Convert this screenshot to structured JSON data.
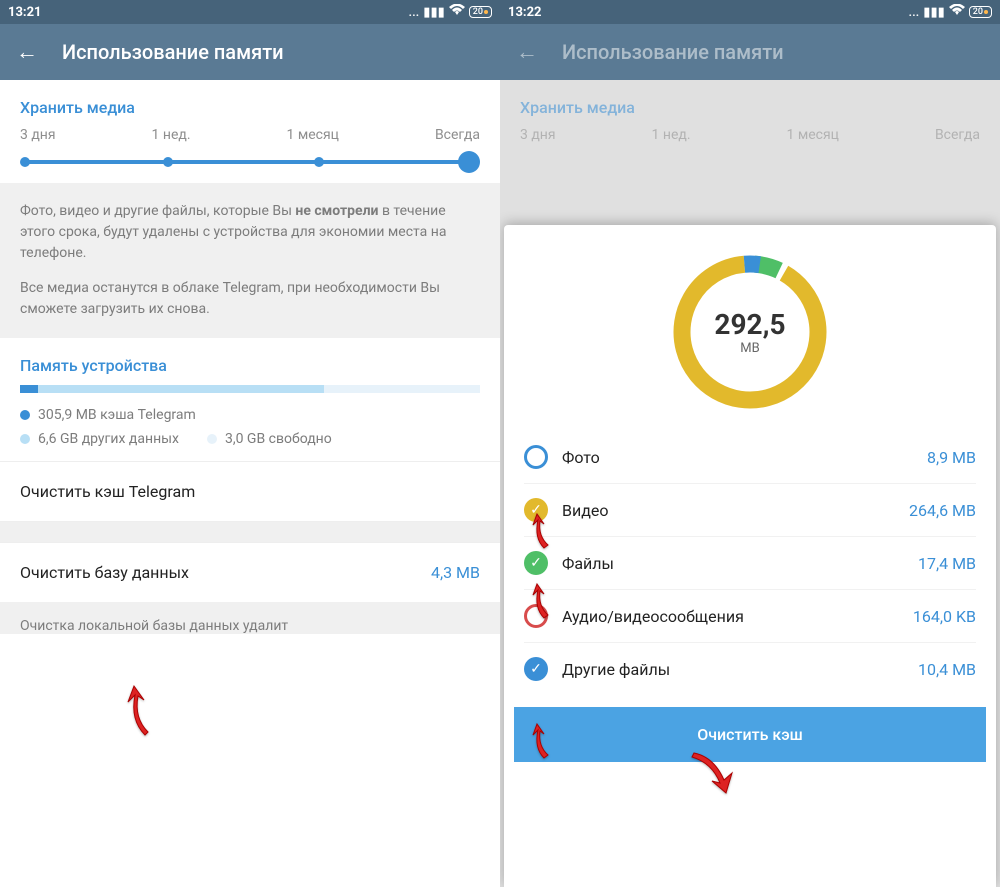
{
  "left": {
    "status": {
      "time": "13:21",
      "battery": "20"
    },
    "appbar": {
      "title": "Использование памяти"
    },
    "keep_media": {
      "title": "Хранить медиа",
      "ticks": [
        "3 дня",
        "1 нед.",
        "1 месяц",
        "Всегда"
      ]
    },
    "info": {
      "p1a": "Фото, видео и другие файлы, которые Вы ",
      "p1b": "не смотрели",
      "p1c": " в течение этого срока, будут удалены с устройства для экономии места на телефоне.",
      "p2": "Все медиа останутся в облаке Telegram, при необходимости Вы сможете загрузить их снова."
    },
    "device_memory": {
      "title": "Память устройства",
      "legend1": "305,9 MB кэша Telegram",
      "legend2": "6,6 GB других данных",
      "legend3": "3,0 GB свободно"
    },
    "clear_cache": {
      "label": "Очистить кэш Telegram"
    },
    "clear_db": {
      "label": "Очистить базу данных",
      "value": "4,3 MB"
    },
    "note": "Очистка локальной базы данных удалит"
  },
  "right": {
    "status": {
      "time": "13:22",
      "battery": "20"
    },
    "appbar": {
      "title": "Использование памяти"
    },
    "keep_media": {
      "title": "Хранить медиа",
      "ticks": [
        "3 дня",
        "1 нед.",
        "1 месяц",
        "Всегда"
      ]
    },
    "dialog": {
      "total": "292,5",
      "unit": "MB",
      "categories": [
        {
          "label": "Фото",
          "size": "8,9 MB",
          "chk": "empty"
        },
        {
          "label": "Видео",
          "size": "264,6 MB",
          "chk": "yellow"
        },
        {
          "label": "Файлы",
          "size": "17,4 MB",
          "chk": "green"
        },
        {
          "label": "Аудио/видеосообщения",
          "size": "164,0 KB",
          "chk": "empty-red"
        },
        {
          "label": "Другие файлы",
          "size": "10,4 MB",
          "chk": "blue"
        }
      ],
      "button": "Очистить кэш"
    }
  }
}
